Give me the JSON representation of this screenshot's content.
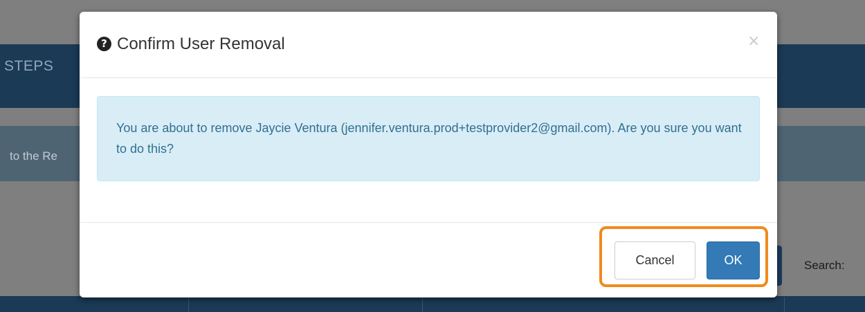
{
  "background": {
    "header_text": "STEPS",
    "notice_text": "to the Re",
    "search_label": "Search:"
  },
  "modal": {
    "icon": "question-circle-icon",
    "title": "Confirm User Removal",
    "close_glyph": "×",
    "message": "You are about to remove Jaycie Ventura (jennifer.ventura.prod+testprovider2@gmail.com). Are you sure you want to do this?",
    "buttons": {
      "cancel": "Cancel",
      "ok": "OK"
    }
  },
  "colors": {
    "primary": "#337ab7",
    "info_bg": "#d9edf7",
    "info_text": "#31708f",
    "highlight": "#f08a1c"
  }
}
